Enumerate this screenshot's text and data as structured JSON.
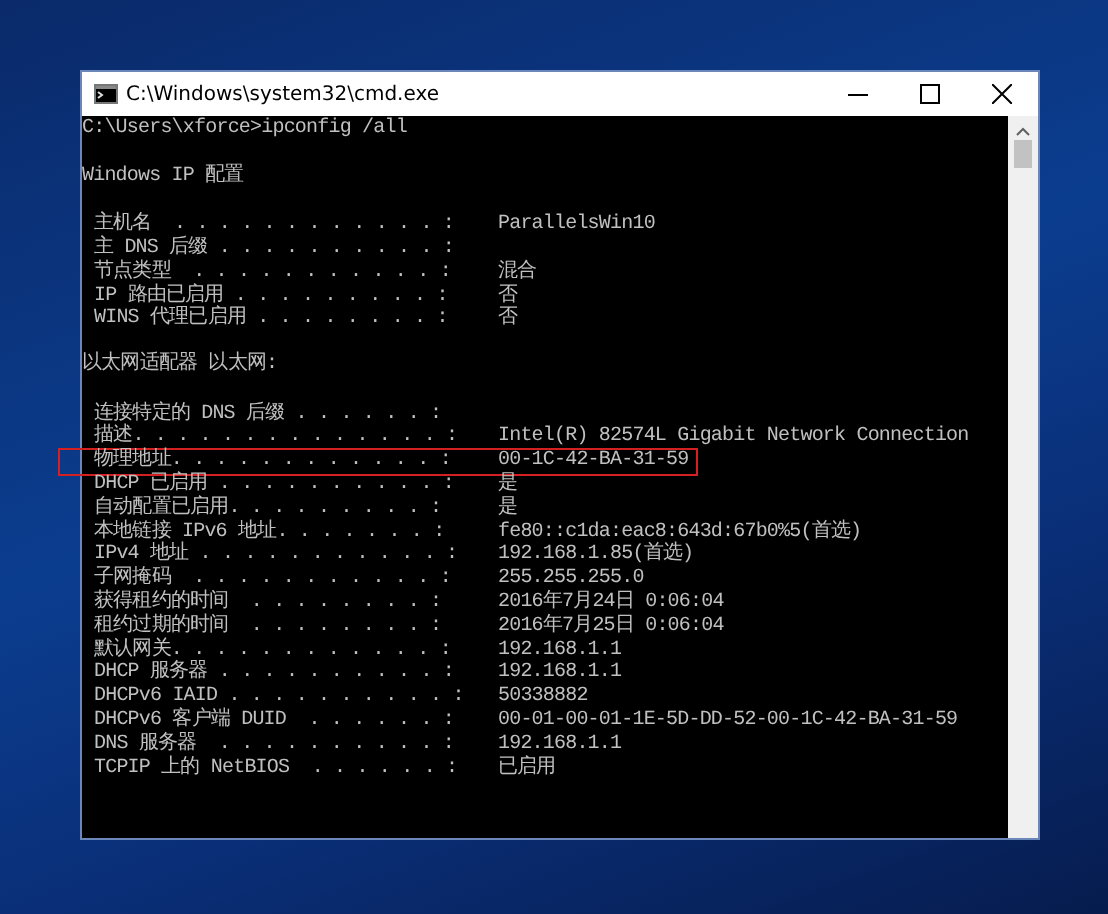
{
  "window": {
    "title": "C:\\Windows\\system32\\cmd.exe"
  },
  "lines": [
    {
      "kind": "text",
      "text": "C:\\Users\\xforce>ipconfig /all"
    },
    {
      "kind": "blank"
    },
    {
      "kind": "text",
      "text": "Windows IP 配置"
    },
    {
      "kind": "blank"
    },
    {
      "kind": "entry",
      "label": "主机名  . . . . . . . . . . . . :",
      "value": "ParallelsWin10",
      "highlighted": false
    },
    {
      "kind": "entry",
      "label": "主 DNS 后缀 . . . . . . . . . . :",
      "highlighted": false
    },
    {
      "kind": "entry",
      "label": "节点类型  . . . . . . . . . . . :",
      "value": "混合",
      "highlighted": false
    },
    {
      "kind": "entry",
      "label": "IP 路由已启用 . . . . . . . . . :",
      "value": "否",
      "highlighted": false
    },
    {
      "kind": "entry",
      "label": "WINS 代理已启用 . . . . . . . . :",
      "value": "否",
      "highlighted": false
    },
    {
      "kind": "blank"
    },
    {
      "kind": "heading",
      "text": "以太网适配器 以太网:"
    },
    {
      "kind": "blank"
    },
    {
      "kind": "entry",
      "label": "连接特定的 DNS 后缀 . . . . . . :",
      "highlighted": false
    },
    {
      "kind": "entry",
      "label": "描述. . . . . . . . . . . . . . :",
      "value": "Intel(R) 82574L Gigabit Network Connection",
      "highlighted": false
    },
    {
      "kind": "entry",
      "label": "物理地址. . . . . . . . . . . . :",
      "value": "00-1C-42-BA-31-59",
      "highlighted": true
    },
    {
      "kind": "entry",
      "label": "DHCP 已启用 . . . . . . . . . . :",
      "value": "是",
      "highlighted": false
    },
    {
      "kind": "entry",
      "label": "自动配置已启用. . . . . . . . . :",
      "value": "是",
      "highlighted": false
    },
    {
      "kind": "entry",
      "label": "本地链接 IPv6 地址. . . . . . . :",
      "value": "fe80::c1da:eac8:643d:67b0%5(首选)",
      "highlighted": false
    },
    {
      "kind": "entry",
      "label": "IPv4 地址 . . . . . . . . . . . :",
      "value": "192.168.1.85(首选)",
      "highlighted": false
    },
    {
      "kind": "entry",
      "label": "子网掩码  . . . . . . . . . . . :",
      "value": "255.255.255.0",
      "highlighted": false
    },
    {
      "kind": "entry",
      "label": "获得租约的时间  . . . . . . . . :",
      "value": "2016年7月24日 0:06:04",
      "highlighted": false
    },
    {
      "kind": "entry",
      "label": "租约过期的时间  . . . . . . . . :",
      "value": "2016年7月25日 0:06:04",
      "highlighted": false
    },
    {
      "kind": "entry",
      "label": "默认网关. . . . . . . . . . . . :",
      "value": "192.168.1.1",
      "highlighted": false
    },
    {
      "kind": "entry",
      "label": "DHCP 服务器 . . . . . . . . . . :",
      "value": "192.168.1.1",
      "highlighted": false
    },
    {
      "kind": "entry",
      "label": "DHCPv6 IAID . . . . . . . . . . :",
      "value": "50338882",
      "highlighted": false
    },
    {
      "kind": "entry",
      "label": "DHCPv6 客户端 DUID  . . . . . . :",
      "value": "00-01-00-01-1E-5D-DD-52-00-1C-42-BA-31-59",
      "highlighted": false
    },
    {
      "kind": "entry",
      "label": "DNS 服务器  . . . . . . . . . . :",
      "value": "192.168.1.1",
      "highlighted": false
    },
    {
      "kind": "entry",
      "label": "TCPIP 上的 NetBIOS  . . . . . . :",
      "value": "已启用",
      "highlighted": false
    }
  ]
}
